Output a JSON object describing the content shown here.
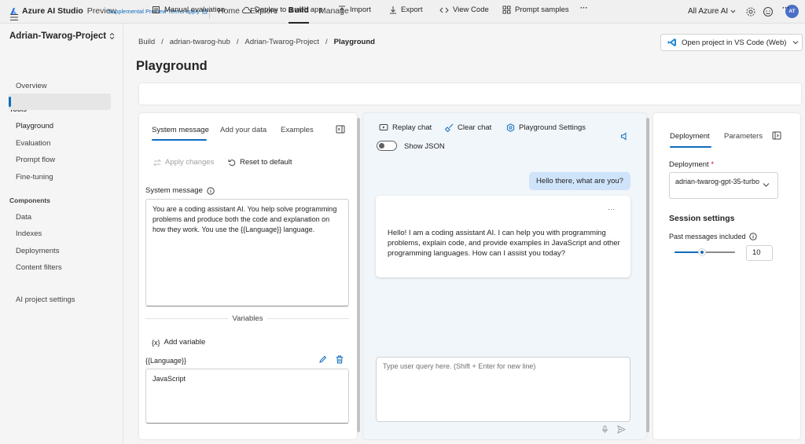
{
  "app": {
    "name": "Azure AI Studio",
    "preview": "Preview",
    "supplemental": "Supplemental Preview Terms apply",
    "nav": [
      "Home",
      "Explore",
      "Build",
      "Manage"
    ],
    "scope": "All Azure AI",
    "avatar_initials": "AT"
  },
  "sidebar": {
    "project": "Adrian-Twarog-Project",
    "overview": "Overview",
    "tools_header": "Tools",
    "tools": [
      "Playground",
      "Evaluation",
      "Prompt flow",
      "Fine-tuning"
    ],
    "components_header": "Components",
    "components": [
      "Data",
      "Indexes",
      "Deployments",
      "Content filters"
    ],
    "settings": "AI project settings"
  },
  "breadcrumb": [
    "Build",
    "adrian-twarog-hub",
    "Adrian-Twarog-Project",
    "Playground"
  ],
  "page_title": "Playground",
  "vscode_button": "Open project in VS Code (Web)",
  "toolbar": {
    "manual_eval": "Manual evaluation",
    "deploy": "Deploy to a web app",
    "import": "Import",
    "export": "Export",
    "view_code": "View Code",
    "prompt_samples": "Prompt samples",
    "more": "···"
  },
  "left": {
    "tabs": [
      "System message",
      "Add your data",
      "Examples"
    ],
    "apply_changes": "Apply changes",
    "reset": "Reset to default",
    "system_label": "System message",
    "system_text": "You are a coding assistant AI. You help solve programming problems and produce both the code and explanation on how they work. You use the {{Language}} language.",
    "variables": "Variables",
    "add_variable": "Add variable",
    "variable_name": "{{Language}}",
    "variable_value": "JavaScript"
  },
  "chat": {
    "replay": "Replay chat",
    "clear": "Clear chat",
    "settings": "Playground Settings",
    "show_json": "Show JSON",
    "user_message": "Hello there, what are you?",
    "bot_message": "Hello! I am a coding assistant AI. I can help you with programming problems, explain code, and provide examples in JavaScript and other programming languages. How can I assist you today?",
    "bot_more": "···",
    "input_placeholder": "Type user query here. (Shift + Enter for new line)"
  },
  "right": {
    "tabs": [
      "Deployment",
      "Parameters"
    ],
    "deployment_label": "Deployment",
    "required_mark": "*",
    "deployment_value": "adrian-twarog-gpt-35-turbo",
    "session_settings": "Session settings",
    "past_messages_label": "Past messages included",
    "past_messages_value": "10",
    "slider_fraction": 0.45
  },
  "colors": {
    "accent": "#0f6cbd",
    "user_bubble": "#cfe4fa",
    "chat_bg": "#f1f6fb"
  }
}
